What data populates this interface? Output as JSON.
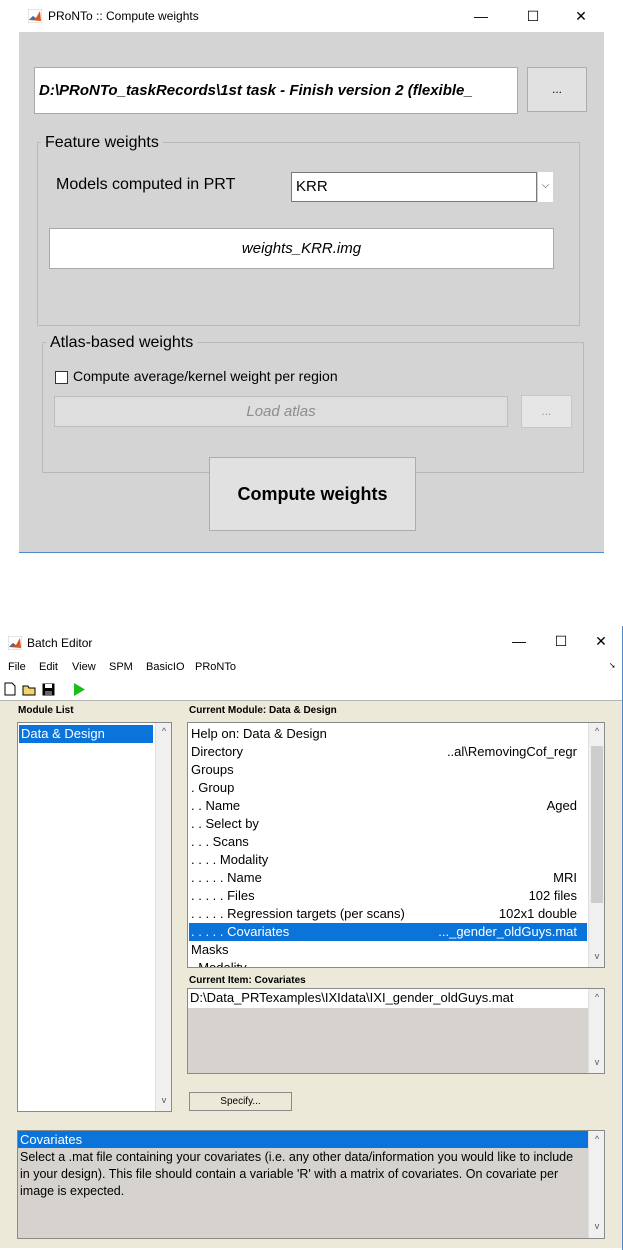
{
  "compute_window": {
    "title": "PRoNTo :: Compute weights",
    "controls": {
      "minimize": "—",
      "maximize": "☐",
      "close": "✕"
    },
    "path_value": "D:\\PRoNTo_taskRecords\\1st task - Finish version 2 (flexible_",
    "browse_label": "...",
    "feature_weights": {
      "title": "Feature weights",
      "models_label": "Models computed in PRT",
      "model_selected": "KRR",
      "weights_file": "weights_KRR.img"
    },
    "atlas_weights": {
      "title": "Atlas-based weights",
      "checkbox_label": "Compute average/kernel weight per region",
      "checked": false,
      "load_atlas_label": "Load atlas",
      "browse_label": "..."
    },
    "compute_button_label": "Compute weights"
  },
  "batch_editor": {
    "title": "Batch Editor",
    "controls": {
      "minimize": "—",
      "maximize": "☐",
      "close": "✕"
    },
    "menu": [
      "File",
      "Edit",
      "View",
      "SPM",
      "BasicIO",
      "PRoNTo"
    ],
    "module_list_label": "Module List",
    "modules": [
      "Data & Design"
    ],
    "current_module_label": "Current Module: Data & Design",
    "module_items": [
      {
        "left": "Help on: Data & Design",
        "right": ""
      },
      {
        "left": "Directory",
        "right": "..al\\RemovingCof_regr"
      },
      {
        "left": "Groups",
        "right": ""
      },
      {
        "left": ". Group",
        "right": ""
      },
      {
        "left": ". . Name",
        "right": "Aged"
      },
      {
        "left": ". . Select by",
        "right": ""
      },
      {
        "left": ". . . Scans",
        "right": ""
      },
      {
        "left": ". . . . Modality",
        "right": ""
      },
      {
        "left": ". . . . . Name",
        "right": "MRI"
      },
      {
        "left": ". . . . . Files",
        "right": "102 files"
      },
      {
        "left": ". . . . . Regression targets (per scans)",
        "right": "102x1 double"
      },
      {
        "left": ". . . . . Covariates",
        "right": "..._gender_oldGuys.mat"
      },
      {
        "left": "Masks",
        "right": ""
      },
      {
        "left": ". Modality",
        "right": ""
      }
    ],
    "selected_index": 11,
    "current_item_label": "Current Item: Covariates",
    "current_item_value": "D:\\Data_PRTexamples\\IXIdata\\IXI_gender_oldGuys.mat",
    "specify_label": "Specify...",
    "help_title": "Covariates",
    "help_text": "Select  a  .mat file containing your covariates (i.e. any other data/information you would like to  include in your design). This file should contain a variable 'R' with a matrix of covariates. On covariate per image is expected."
  }
}
